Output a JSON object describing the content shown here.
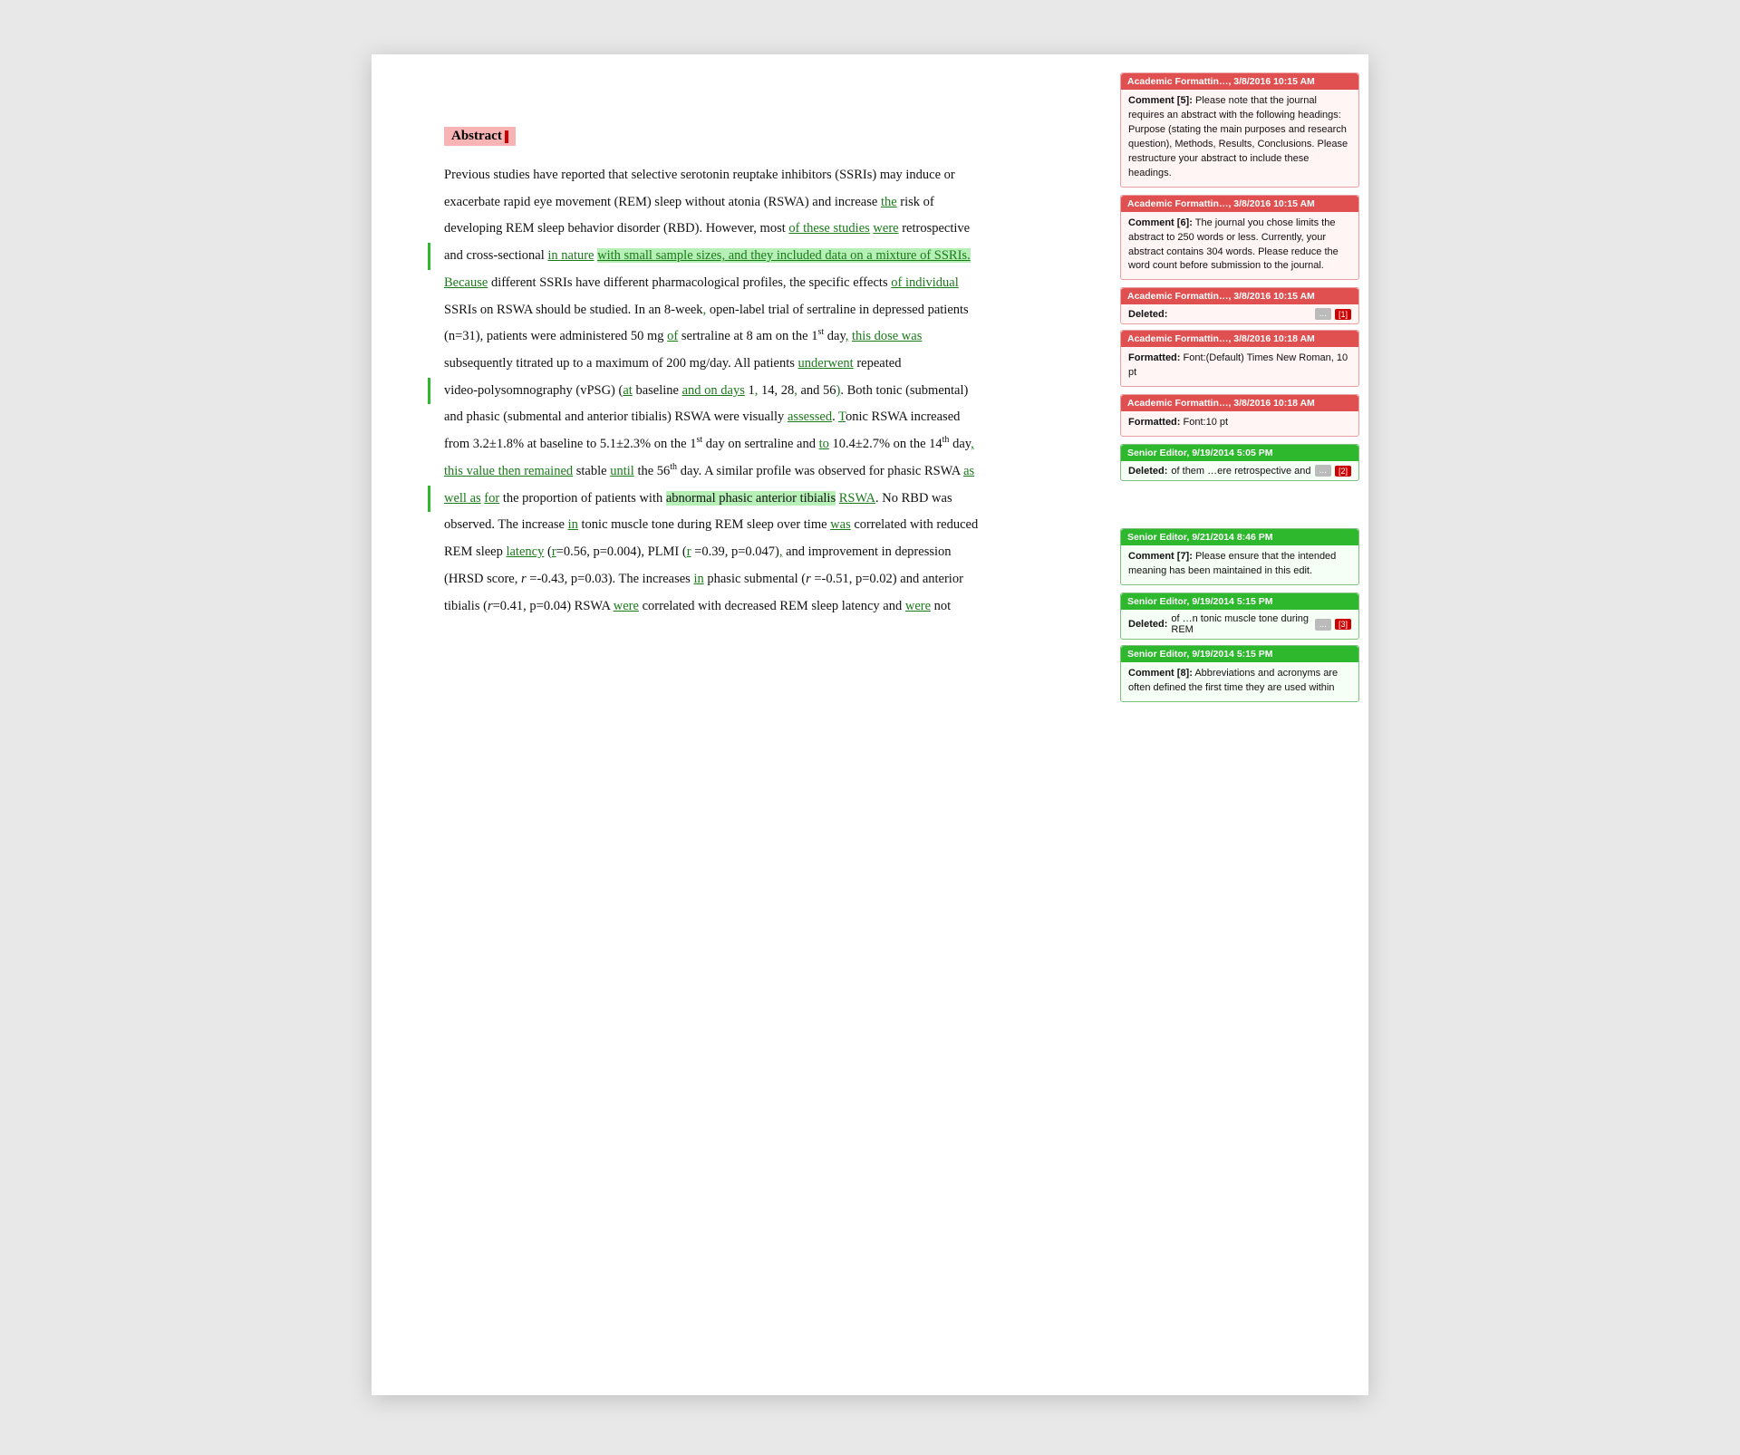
{
  "document": {
    "abstract_heading": "Abstract",
    "paragraphs": [
      {
        "id": "p1",
        "text": "Previous studies have reported that selective serotonin reuptake inhibitors (SSRIs) may induce or exacerbate rapid eye movement (REM) sleep without atonia (RSWA) and increase the risk of developing REM sleep behavior disorder (RBD). However, most of these studies were retrospective and cross-sectional in nature with small sample sizes, and they included data on a mixture of SSRIs. Because different SSRIs have different pharmacological profiles, the specific effects of individual SSRIs on RSWA should be studied. In an 8-week, open-label trial of sertraline in depressed patients (n=31), patients were administered 50 mg of sertraline at 8 am on the 1st day, this dose was subsequently titrated up to a maximum of 200 mg/day. All patients underwent repeated video-polysomnography (vPSG) (at baseline and on days 1, 14, 28, and 56). Both tonic (submental) and phasic (submental and anterior tibialis) RSWA were visually assessed. Tonic RSWA increased from 3.2±1.8% at baseline to 5.1±2.3% on the 1st day on sertraline and to 10.4±2.7% on the 14th day, this value then remained stable until the 56th day. A similar profile was observed for phasic RSWA as well as for the proportion of patients with abnormal phasic anterior tibialis RSWA. No RBD was observed. The increase in tonic muscle tone during REM sleep over time was correlated with reduced REM sleep latency (r=0.56, p=0.004), PLMI (r =0.39, p=0.047), and improvement in depression (HRSD score, r =-0.43, p=0.03). The increases in phasic submental (r =-0.51, p=0.02) and anterior tibialis (r=0.41, p=0.04) RSWA were correlated with decreased REM sleep latency and were not"
      }
    ]
  },
  "sidebar": {
    "comments": [
      {
        "id": "c1",
        "type": "comment",
        "color": "red",
        "author": "Academic Formattin…",
        "date": "3/8/2016 10:15 AM",
        "label": "Comment [5]:",
        "body": "Please note that the journal requires an abstract with the following headings: Purpose (stating the main purposes and research question), Methods, Results, Conclusions. Please restructure your abstract to include these headings."
      },
      {
        "id": "c2",
        "type": "comment",
        "color": "red",
        "author": "Academic Formattin…",
        "date": "3/8/2016 10:15 AM",
        "label": "Comment [6]:",
        "body": "The journal you chose limits the abstract to 250 words or less. Currently, your abstract contains 304 words. Please reduce the word count before submission to the journal."
      },
      {
        "id": "d1",
        "type": "deleted",
        "color": "red",
        "author": "Academic Formattin…",
        "date": "3/8/2016 10:15 AM",
        "label": "Deleted:",
        "body": "",
        "ellipsis": "...",
        "num": "[1]"
      },
      {
        "id": "f1",
        "type": "formatted",
        "color": "red",
        "author": "Academic Formattin…",
        "date": "3/8/2016 10:18 AM",
        "label": "Formatted:",
        "body": "Font:(Default) Times New Roman, 10 pt"
      },
      {
        "id": "f2",
        "type": "formatted",
        "color": "red",
        "author": "Academic Formattin…",
        "date": "3/8/2016 10:18 AM",
        "label": "Formatted:",
        "body": "Font:10 pt"
      },
      {
        "id": "d2",
        "type": "deleted",
        "color": "green",
        "author": "Senior Editor",
        "date": "9/19/2014 5:05 PM",
        "label": "Deleted:",
        "body": "of them …ere retrospective and",
        "ellipsis": "...",
        "num": "[2]"
      },
      {
        "id": "spacer1",
        "type": "spacer"
      },
      {
        "id": "c3",
        "type": "comment",
        "color": "green",
        "author": "Senior Editor",
        "date": "9/21/2014 8:46 PM",
        "label": "Comment [7]:",
        "body": "Please ensure that the intended meaning has been maintained in this edit."
      },
      {
        "id": "d3",
        "type": "deleted",
        "color": "green",
        "author": "Senior Editor",
        "date": "9/19/2014 5:15 PM",
        "label": "Deleted:",
        "body": "of …n tonic muscle tone during REM",
        "ellipsis": "...",
        "num": "[3]"
      },
      {
        "id": "c4",
        "type": "comment",
        "color": "green",
        "author": "Senior Editor",
        "date": "9/19/2014 5:15 PM",
        "label": "Comment [8]:",
        "body": "Abbreviations and acronyms are often defined the first time they are used within"
      }
    ]
  }
}
